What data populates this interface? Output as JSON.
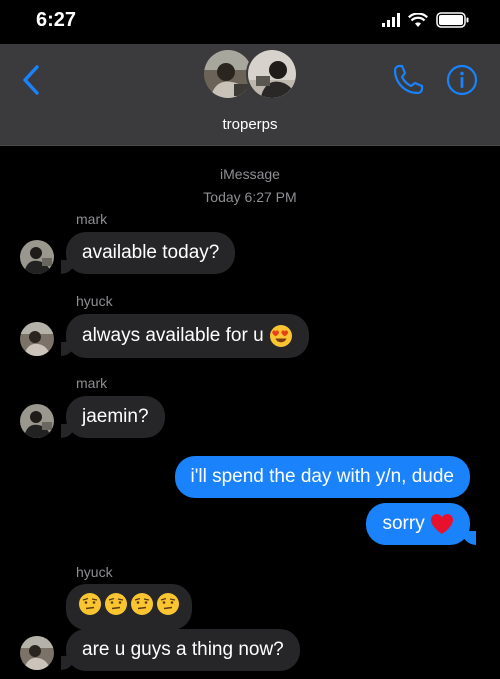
{
  "status_bar": {
    "time": "6:27"
  },
  "header": {
    "group_name": "troperps"
  },
  "thread": {
    "service": "iMessage",
    "timestamp": "Today 6:27 PM",
    "messages": [
      {
        "sender": "mark",
        "text": "available today?"
      },
      {
        "sender": "hyuck",
        "text": "always available for u"
      },
      {
        "sender": "mark",
        "text": "jaemin?"
      },
      {
        "sender": "me",
        "text": "i'll spend the day with y/n, dude"
      },
      {
        "sender": "me",
        "text": "sorry"
      },
      {
        "sender": "hyuck",
        "text": ""
      },
      {
        "sender": "hyuck",
        "text": "are u guys a thing now?"
      }
    ]
  },
  "icons": {
    "back": "chevron-left-icon",
    "call": "phone-icon",
    "info": "info-icon",
    "heart_eyes": "heart-eyes-emoji-icon",
    "red_heart": "red-heart-emoji-icon",
    "raised_eyebrow": "raised-eyebrow-emoji-icon"
  },
  "colors": {
    "accent": "#1a82fb",
    "bubble_incoming": "#262628",
    "header_bg": "#3b3b3d",
    "meta_text": "#8e8e93"
  }
}
